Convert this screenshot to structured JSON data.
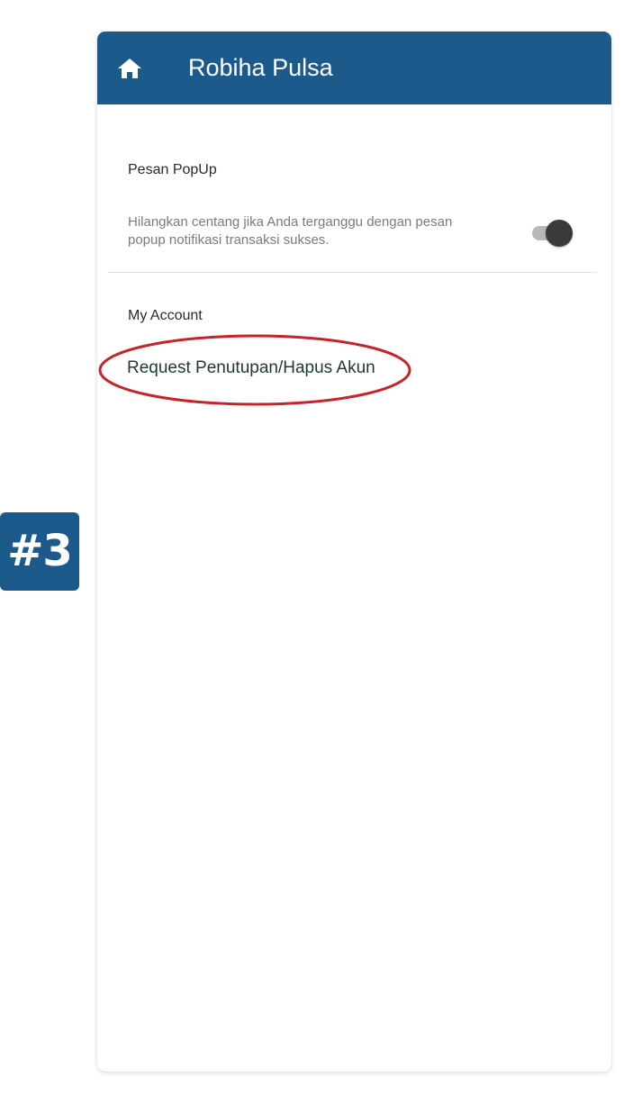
{
  "step_badge": {
    "label": "#3"
  },
  "app_bar": {
    "title": "Robiha Pulsa",
    "home_icon": "home-icon",
    "color": "#1d5a8c"
  },
  "popup_section": {
    "title": "Pesan PopUp",
    "description": "Hilangkan centang jika Anda terganggu dengan pesan popup notifikasi transaksi sukses.",
    "toggle_state": "on"
  },
  "account_section": {
    "title": "My Account",
    "request_link": "Request Penutupan/Hapus Akun"
  },
  "annotation": {
    "highlight_color": "#c4252c"
  }
}
